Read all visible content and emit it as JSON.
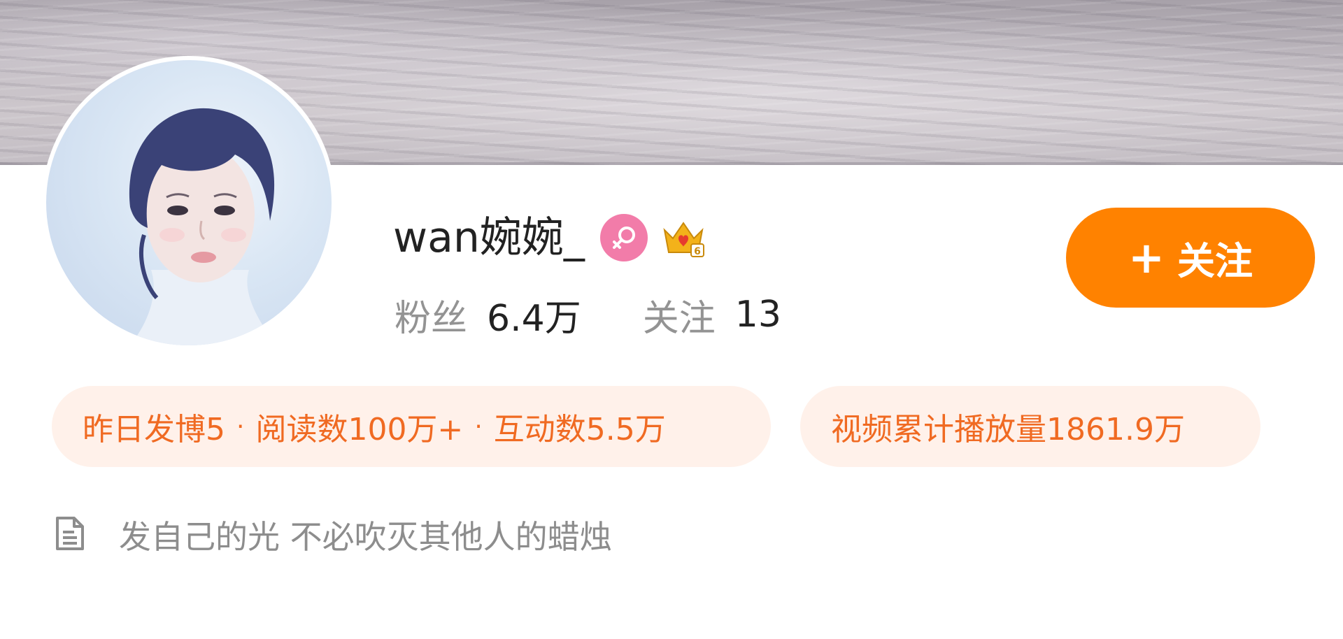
{
  "profile": {
    "username": "wan婉婉_",
    "gender_icon": "female-icon",
    "vip_icon": "crown-vip-icon",
    "vip_level": "6"
  },
  "stats": {
    "fans_label": "粉丝",
    "fans_value": "6.4万",
    "following_label": "关注",
    "following_value": "13"
  },
  "follow_button": {
    "plus": "+",
    "label": "关注"
  },
  "data_pills": {
    "posts_yesterday": "昨日发博5",
    "separator": "·",
    "reads": "阅读数100万+",
    "interactions": "互动数5.5万",
    "video_plays": "视频累计播放量1861.9万"
  },
  "bio": {
    "icon": "document-icon",
    "text": "发自己的光 不必吹灭其他人的蜡烛"
  },
  "colors": {
    "accent": "#ff8200",
    "pill_bg": "#fff1ea",
    "pill_text": "#f06a22",
    "gender_pink": "#f27ca9",
    "muted_text": "#939393"
  }
}
